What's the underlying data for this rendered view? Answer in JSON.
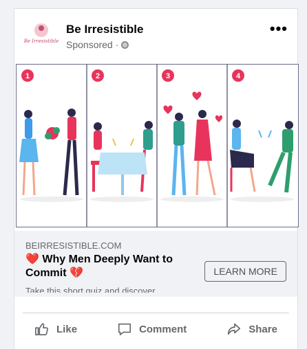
{
  "post": {
    "page_name": "Be Irresistible",
    "logo_text": "Be Irresistible",
    "sponsored": "Sponsored",
    "sponsored_separator": "·",
    "more_icon": "more-horizontal-icon",
    "more_label": "•••"
  },
  "image": {
    "panels": [
      {
        "number": "1"
      },
      {
        "number": "2"
      },
      {
        "number": "3"
      },
      {
        "number": "4"
      }
    ],
    "badge_color": "#e8345c"
  },
  "link": {
    "domain": "BEIRRESISTIBLE.COM",
    "headline_heart_left": "❤️",
    "headline_text": "Why Men Deeply Want to Commit",
    "headline_heart_right": "💔",
    "description": "Take this short quiz and discover...",
    "cta": "LEARN MORE"
  },
  "actions": {
    "like": "Like",
    "comment": "Comment",
    "share": "Share"
  },
  "colors": {
    "background": "#f0f2f5",
    "text_primary": "#050505",
    "text_secondary": "#65676b"
  }
}
